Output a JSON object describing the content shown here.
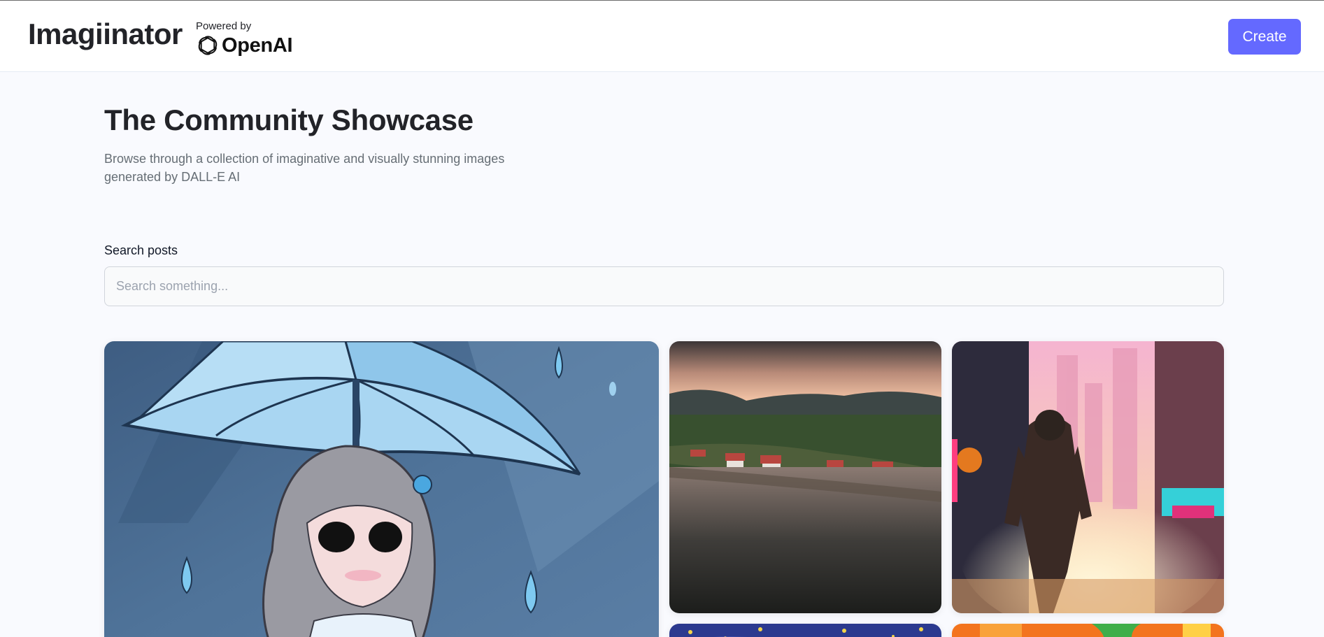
{
  "header": {
    "brand": "Imagiinator",
    "powered_by": "Powered by",
    "openai_label": "OpenAI",
    "create_label": "Create",
    "accent_color": "#6469ff"
  },
  "hero": {
    "title": "The Community Showcase",
    "subtitle": "Browse through a collection of imaginative and visually stunning images generated by DALL-E AI"
  },
  "search": {
    "label": "Search posts",
    "placeholder": "Search something..."
  },
  "gallery": {
    "posts": [
      {
        "subject": "anime girl with umbrella in rain"
      },
      {
        "subject": "lakeside village at sunset"
      },
      {
        "subject": "figure in neon futuristic city street"
      },
      {
        "subject": "starry painterly night scene"
      },
      {
        "subject": "bright orange and green abstract"
      }
    ]
  }
}
